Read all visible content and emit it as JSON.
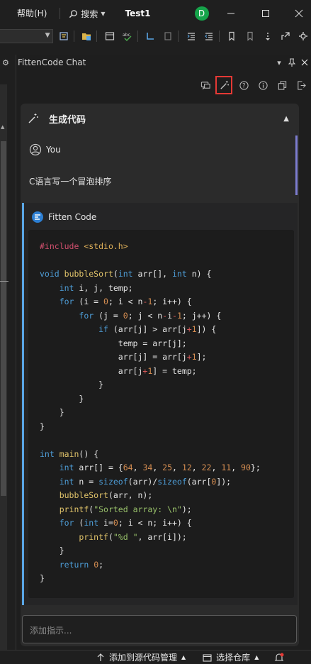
{
  "menu": {
    "help": "帮助(H)",
    "search": "搜索",
    "app_title": "Test1",
    "avatar_initial": "D"
  },
  "panel": {
    "title": "FittenCode Chat"
  },
  "conversation": {
    "title": "生成代码"
  },
  "user_message": {
    "author": "You",
    "text": "C语言写一个冒泡排序"
  },
  "bot_message": {
    "author": "Fitten Code"
  },
  "input": {
    "placeholder": "添加指示..."
  },
  "statusbar": {
    "add_to_source_control": "添加到源代码管理",
    "select_repo": "选择仓库"
  },
  "colors": {
    "accent_user": "#7c7ccf",
    "accent_bot": "#5aa6e6",
    "avatar_bg": "#16a34a",
    "highlight_box": "#e53935"
  },
  "icons": {
    "menubar": [
      "search-icon",
      "minimize-icon",
      "maximize-icon",
      "close-icon"
    ],
    "panel_tools": [
      "comment-icon",
      "magic-wand-icon",
      "help-icon",
      "info-icon",
      "copy-icon",
      "exit-icon"
    ]
  }
}
